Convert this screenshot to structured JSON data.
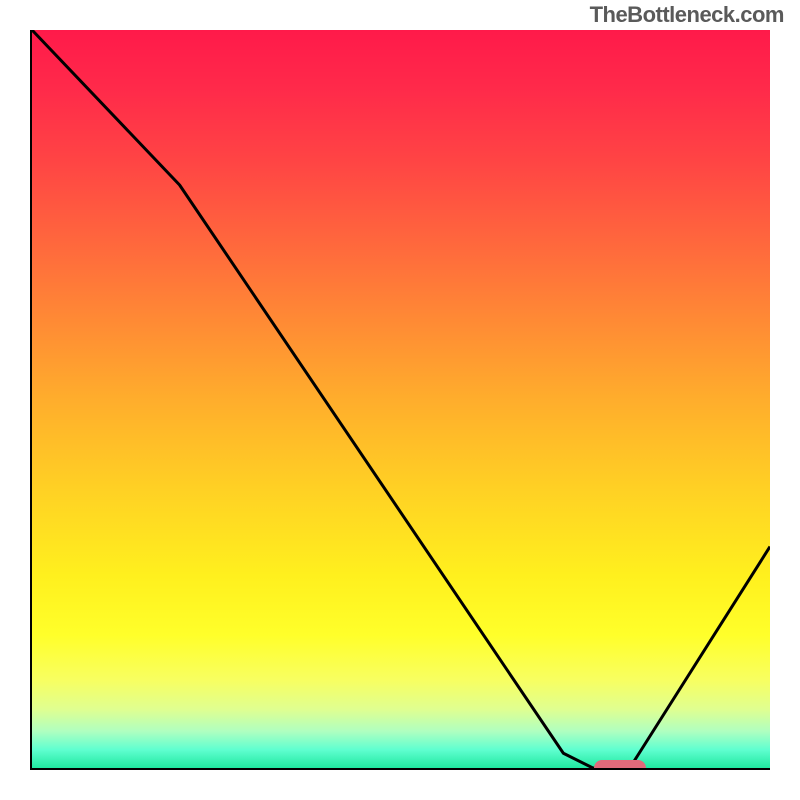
{
  "watermark": "TheBottleneck.com",
  "chart_data": {
    "type": "line",
    "title": "",
    "xlabel": "",
    "ylabel": "",
    "xlim": [
      0,
      100
    ],
    "ylim": [
      0,
      100
    ],
    "series": [
      {
        "name": "bottleneck-curve",
        "x": [
          0,
          20,
          72,
          76,
          81,
          100
        ],
        "y": [
          100,
          79,
          2,
          0,
          0,
          30
        ]
      }
    ],
    "markers": [
      {
        "name": "optimal-range",
        "x_start": 76,
        "x_end": 83,
        "y": 0
      }
    ],
    "gradient_stops": [
      {
        "pos": 0,
        "color": "#ff1a4a"
      },
      {
        "pos": 50,
        "color": "#ffad2c"
      },
      {
        "pos": 82,
        "color": "#ffff2a"
      },
      {
        "pos": 100,
        "color": "#20e8a0"
      }
    ]
  }
}
